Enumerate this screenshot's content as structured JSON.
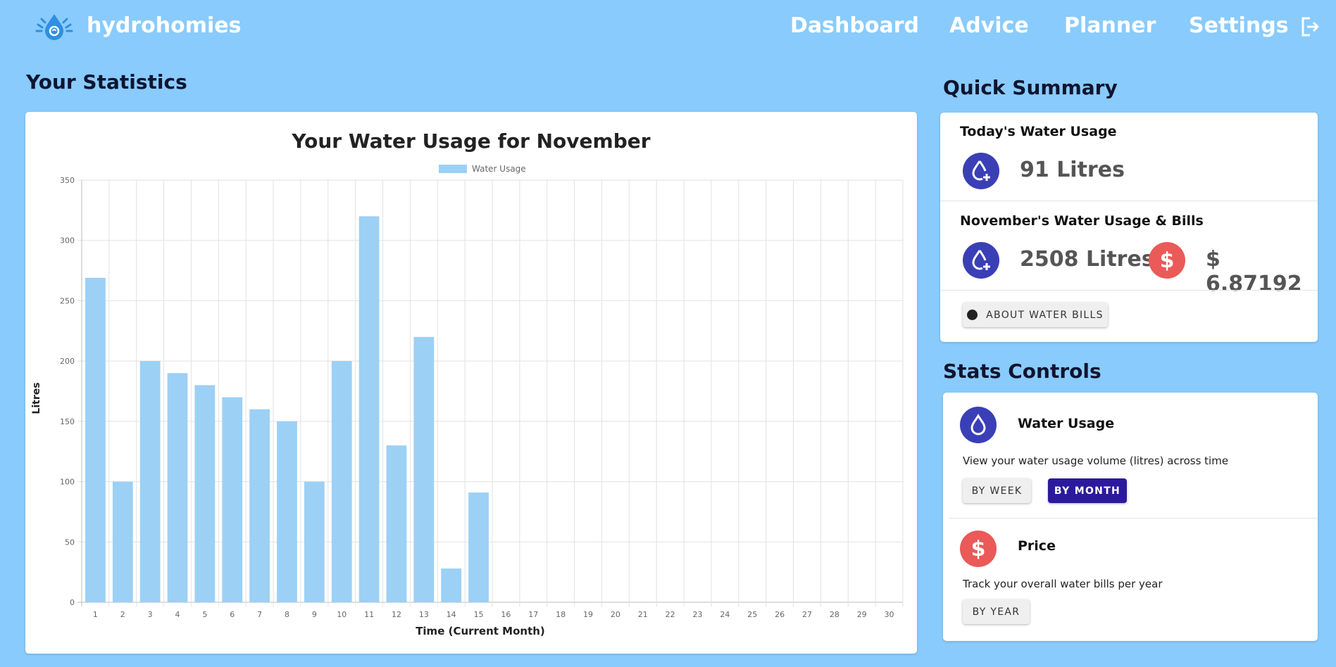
{
  "nav": {
    "brand": "hydrohomies",
    "links": [
      "Dashboard",
      "Advice",
      "Planner",
      "Settings"
    ]
  },
  "colors": {
    "background": "#89cbfc",
    "bar": "#9cd0f5",
    "accent_blue": "#3a3fb6",
    "accent_red": "#e95a59",
    "button_active": "#2b1a9e"
  },
  "stats": {
    "heading": "Your Statistics"
  },
  "summary": {
    "heading": "Quick Summary",
    "today_label": "Today's Water Usage",
    "today_value": "91 Litres",
    "month_label": "November's Water Usage & Bills",
    "month_value": "2508 Litres",
    "month_bill": "$ 6.87192",
    "about_button": "About Water Bills"
  },
  "controls": {
    "heading": "Stats Controls",
    "usage_title": "Water Usage",
    "usage_desc": "View your water usage volume (litres) across time",
    "by_week": "By Week",
    "by_month": "By Month",
    "price_title": "Price",
    "price_desc": "Track your overall water bills per year",
    "by_year": "By Year"
  },
  "chart_data": {
    "type": "bar",
    "title": "Your Water Usage for November",
    "xlabel": "Time (Current Month)",
    "ylabel": "Litres",
    "ylim": [
      0,
      350
    ],
    "yticks": [
      0,
      50,
      100,
      150,
      200,
      250,
      300,
      350
    ],
    "legend": "top",
    "grid": true,
    "categories": [
      "1",
      "2",
      "3",
      "4",
      "5",
      "6",
      "7",
      "8",
      "9",
      "10",
      "11",
      "12",
      "13",
      "14",
      "15",
      "16",
      "17",
      "18",
      "19",
      "20",
      "21",
      "22",
      "23",
      "24",
      "25",
      "26",
      "27",
      "28",
      "29",
      "30"
    ],
    "series": [
      {
        "name": "Water Usage",
        "values": [
          269,
          100,
          200,
          190,
          180,
          170,
          160,
          150,
          100,
          200,
          320,
          130,
          220,
          28,
          91,
          0,
          0,
          0,
          0,
          0,
          0,
          0,
          0,
          0,
          0,
          0,
          0,
          0,
          0,
          0
        ]
      }
    ]
  }
}
